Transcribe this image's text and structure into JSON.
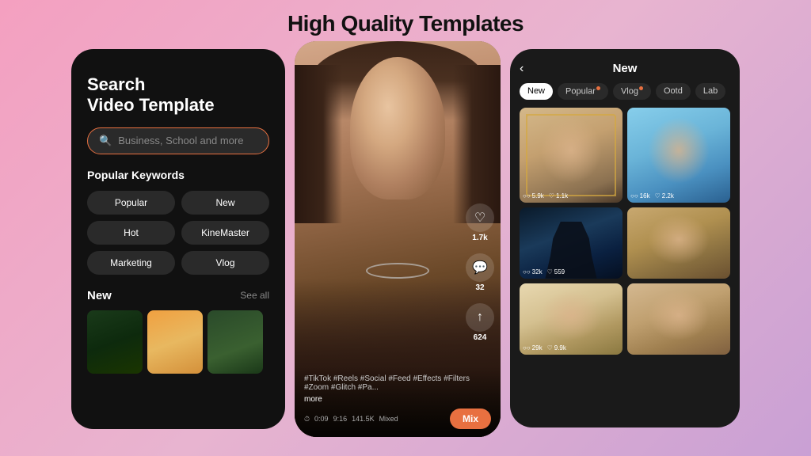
{
  "page": {
    "title": "High Quality Templates"
  },
  "phone1": {
    "search_title": "Search\nVideo Template",
    "search_placeholder": "Business, School and more",
    "popular_keywords_label": "Popular Keywords",
    "keywords": [
      "Popular",
      "New",
      "Hot",
      "KineMaster",
      "Marketing",
      "Vlog"
    ],
    "new_section_label": "New",
    "see_all_label": "See all"
  },
  "phone2": {
    "hashtags": "#TikTok #Reels #Social #Feed #Effects #Filters #Zoom #Glitch #Pa...",
    "more_label": "more",
    "duration": "0:09",
    "resolution": "9:16",
    "views": "141.5K",
    "quality": "Mixed",
    "mix_button_label": "Mix",
    "heart_count": "1.7k",
    "comment_count": "32",
    "share_count": "624"
  },
  "phone3": {
    "back_label": "‹",
    "title": "New",
    "tabs": [
      "New",
      "Popular",
      "Vlog",
      "Ootd",
      "Lab"
    ],
    "active_tab": "New",
    "grid_items": [
      {
        "views": "5.9k",
        "likes": "1.1k"
      },
      {
        "views": "16k",
        "likes": "2.2k"
      },
      {
        "views": "32k",
        "likes": "559"
      },
      {
        "views": "",
        "likes": ""
      },
      {
        "views": "29k",
        "likes": "9.9k"
      },
      {
        "views": "",
        "likes": ""
      }
    ]
  },
  "icons": {
    "search": "🔍",
    "heart": "♡",
    "comment": "💬",
    "share": "↑",
    "back": "‹",
    "play": "▷",
    "clock": "⏱",
    "eye": "○○",
    "like": "♡"
  }
}
